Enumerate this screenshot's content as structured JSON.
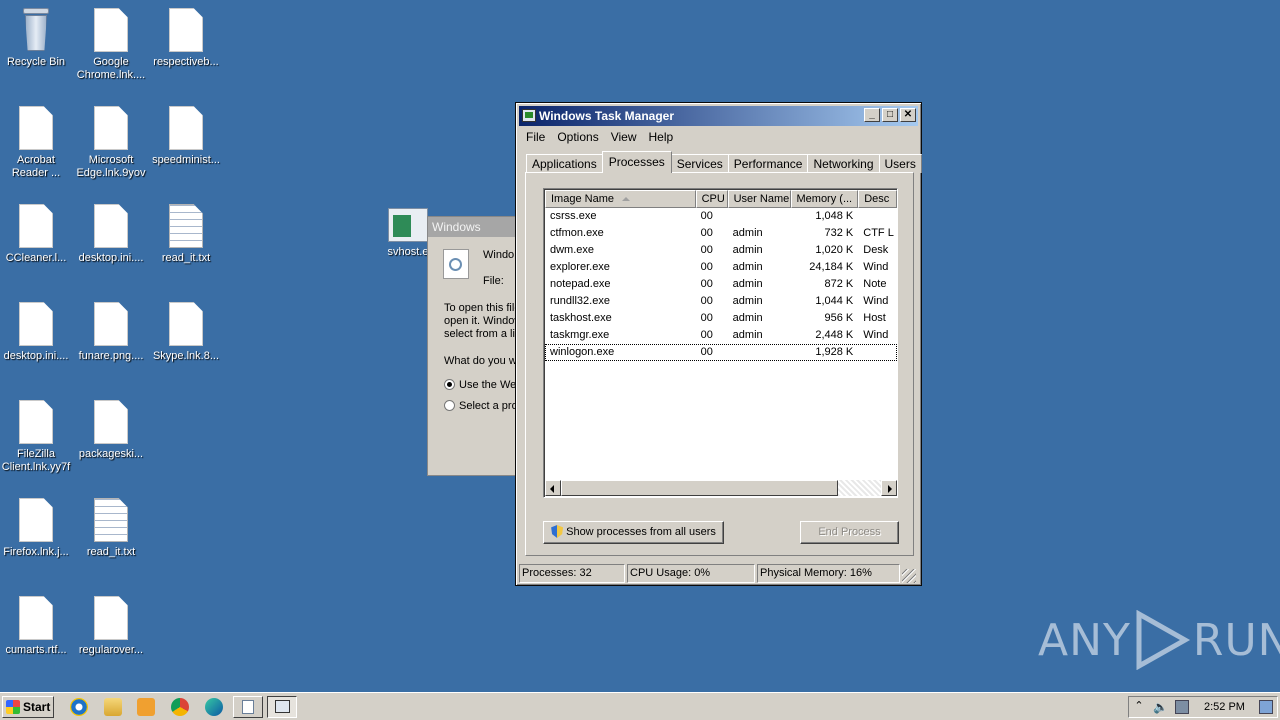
{
  "desktop": {
    "icons": [
      {
        "label": "Recycle Bin",
        "kind": "recycle"
      },
      {
        "label": "Google Chrome.lnk....",
        "kind": "doc"
      },
      {
        "label": "respectiveb...",
        "kind": "doc"
      },
      {
        "label": "Acrobat Reader ...",
        "kind": "doc"
      },
      {
        "label": "Microsoft Edge.lnk.9yov",
        "kind": "doc"
      },
      {
        "label": "speedminist...",
        "kind": "doc"
      },
      {
        "label": "CCleaner.l...",
        "kind": "doc"
      },
      {
        "label": "desktop.ini....",
        "kind": "doc"
      },
      {
        "label": "read_it.txt",
        "kind": "txt"
      },
      {
        "label": "desktop.ini....",
        "kind": "doc"
      },
      {
        "label": "funare.png....",
        "kind": "doc"
      },
      {
        "label": "Skype.lnk.8...",
        "kind": "doc"
      },
      {
        "label": "FileZilla Client.lnk.yy7f",
        "kind": "doc"
      },
      {
        "label": "packageski...",
        "kind": "doc"
      },
      {
        "label": "Firefox.lnk.j...",
        "kind": "doc"
      },
      {
        "label": "read_it.txt",
        "kind": "txt"
      },
      {
        "label": "cumarts.rtf...",
        "kind": "doc"
      },
      {
        "label": "regularover...",
        "kind": "doc"
      }
    ],
    "svhost_label": "svhost.e"
  },
  "bg_dialog": {
    "title": "Windows",
    "line1": "Windo",
    "file_label": "File:",
    "text1": "To open this file",
    "text2": "open it. Window",
    "text3": "select from a lis",
    "question": "What do you w",
    "opt1": "Use the We",
    "opt2": "Select a pro"
  },
  "taskmgr": {
    "title": "Windows Task Manager",
    "menu": [
      "File",
      "Options",
      "View",
      "Help"
    ],
    "tabs": [
      "Applications",
      "Processes",
      "Services",
      "Performance",
      "Networking",
      "Users"
    ],
    "active_tab": "Processes",
    "columns": [
      "Image Name",
      "CPU",
      "User Name",
      "Memory (...",
      "Desc"
    ],
    "processes": [
      {
        "name": "csrss.exe",
        "cpu": "00",
        "user": "",
        "mem": "1,048 K",
        "desc": ""
      },
      {
        "name": "ctfmon.exe",
        "cpu": "00",
        "user": "admin",
        "mem": "732 K",
        "desc": "CTF L"
      },
      {
        "name": "dwm.exe",
        "cpu": "00",
        "user": "admin",
        "mem": "1,020 K",
        "desc": "Desk"
      },
      {
        "name": "explorer.exe",
        "cpu": "00",
        "user": "admin",
        "mem": "24,184 K",
        "desc": "Wind"
      },
      {
        "name": "notepad.exe",
        "cpu": "00",
        "user": "admin",
        "mem": "872 K",
        "desc": "Note"
      },
      {
        "name": "rundll32.exe",
        "cpu": "00",
        "user": "admin",
        "mem": "1,044 K",
        "desc": "Wind"
      },
      {
        "name": "taskhost.exe",
        "cpu": "00",
        "user": "admin",
        "mem": "956 K",
        "desc": "Host"
      },
      {
        "name": "taskmgr.exe",
        "cpu": "00",
        "user": "admin",
        "mem": "2,448 K",
        "desc": "Wind"
      },
      {
        "name": "winlogon.exe",
        "cpu": "00",
        "user": "",
        "mem": "1,928 K",
        "desc": ""
      }
    ],
    "show_all_btn": "Show processes from all users",
    "end_process_btn": "End Process",
    "status": {
      "processes": "Processes: 32",
      "cpu": "CPU Usage: 0%",
      "memory": "Physical Memory: 16%"
    }
  },
  "taskbar": {
    "start": "Start",
    "clock": "2:52 PM"
  },
  "watermark": {
    "left": "ANY",
    "right": "RUN"
  }
}
